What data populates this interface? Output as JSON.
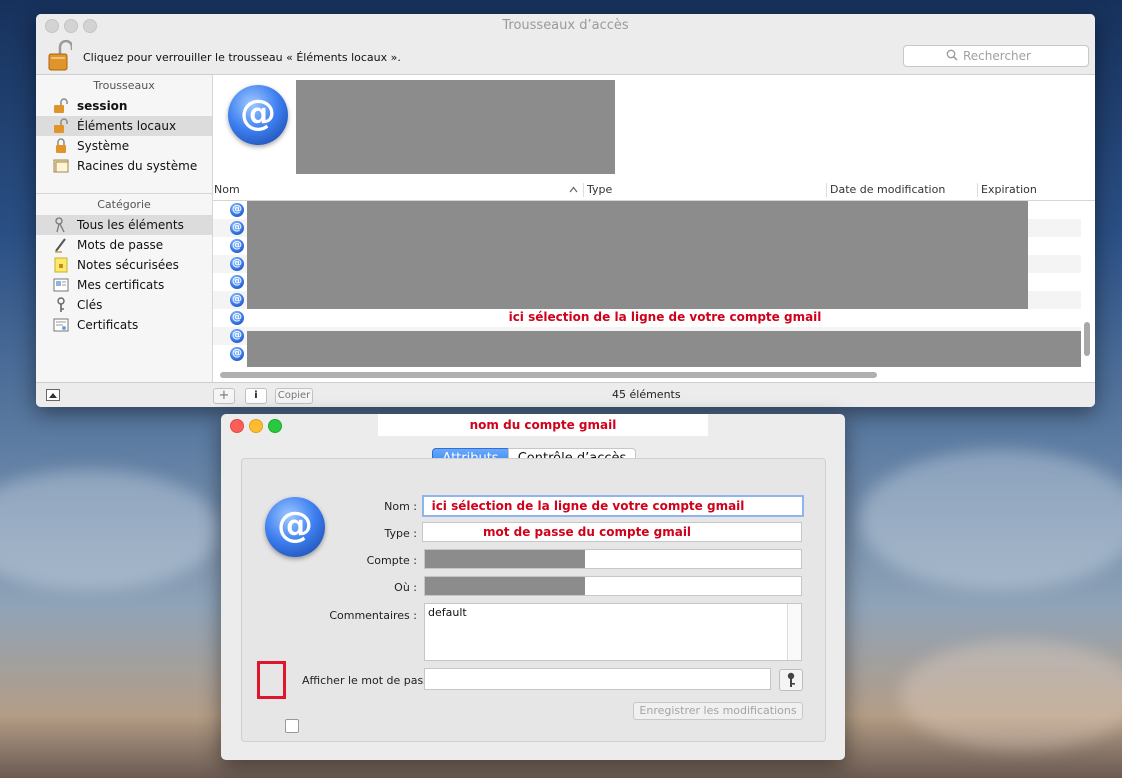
{
  "main_window": {
    "title": "Trousseaux d’accès",
    "lock_message": "Cliquez pour verrouiller le trousseau « Éléments locaux ».",
    "search": {
      "placeholder": "Rechercher"
    },
    "sidebar": {
      "keychains_header": "Trousseaux",
      "keychains": [
        {
          "label": "session",
          "icon": "unlocked-padlock-icon",
          "bold": true,
          "selected": false
        },
        {
          "label": "Éléments locaux",
          "icon": "unlocked-padlock-icon",
          "bold": false,
          "selected": true
        },
        {
          "label": "Système",
          "icon": "padlock-icon",
          "bold": false,
          "selected": false
        },
        {
          "label": "Racines du système",
          "icon": "certificate-folder-icon",
          "bold": false,
          "selected": false
        }
      ],
      "category_header": "Catégorie",
      "categories": [
        {
          "label": "Tous les éléments",
          "icon": "keys-icon",
          "selected": true
        },
        {
          "label": "Mots de passe",
          "icon": "pen-icon",
          "selected": false
        },
        {
          "label": "Notes sécurisées",
          "icon": "secure-note-icon",
          "selected": false
        },
        {
          "label": "Mes certificats",
          "icon": "my-certificate-icon",
          "selected": false
        },
        {
          "label": "Clés",
          "icon": "key-icon",
          "selected": false
        },
        {
          "label": "Certificats",
          "icon": "certificate-icon",
          "selected": false
        }
      ]
    },
    "columns": {
      "name": "Nom",
      "type": "Type",
      "modified": "Date de modification",
      "expiration": "Expiration"
    },
    "selected_row_annotation": "ici sélection de la ligne de votre compte gmail",
    "bottom": {
      "add": "+",
      "info": "i",
      "copy": "Copier",
      "count": "45 éléments"
    }
  },
  "detail_window": {
    "title_annotation": "nom du compte gmail",
    "tabs": {
      "attributes": "Attributs",
      "access_control": "Contrôle d’accès",
      "active": "attributes"
    },
    "labels": {
      "name": "Nom :",
      "type": "Type :",
      "account": "Compte :",
      "where": "Où :",
      "comments": "Commentaires :",
      "show_password": "Afficher le mot de passe :"
    },
    "values": {
      "name_annotation": "ici sélection de la ligne de votre compte gmail",
      "type_annotation": "mot de passe du compte gmail",
      "comments": "default"
    },
    "save_button": "Enregistrer les modifications"
  },
  "colors": {
    "annotation_red": "#d0021b",
    "accent_blue": "#3b82f0",
    "redaction_gray": "#8c8c8c"
  }
}
